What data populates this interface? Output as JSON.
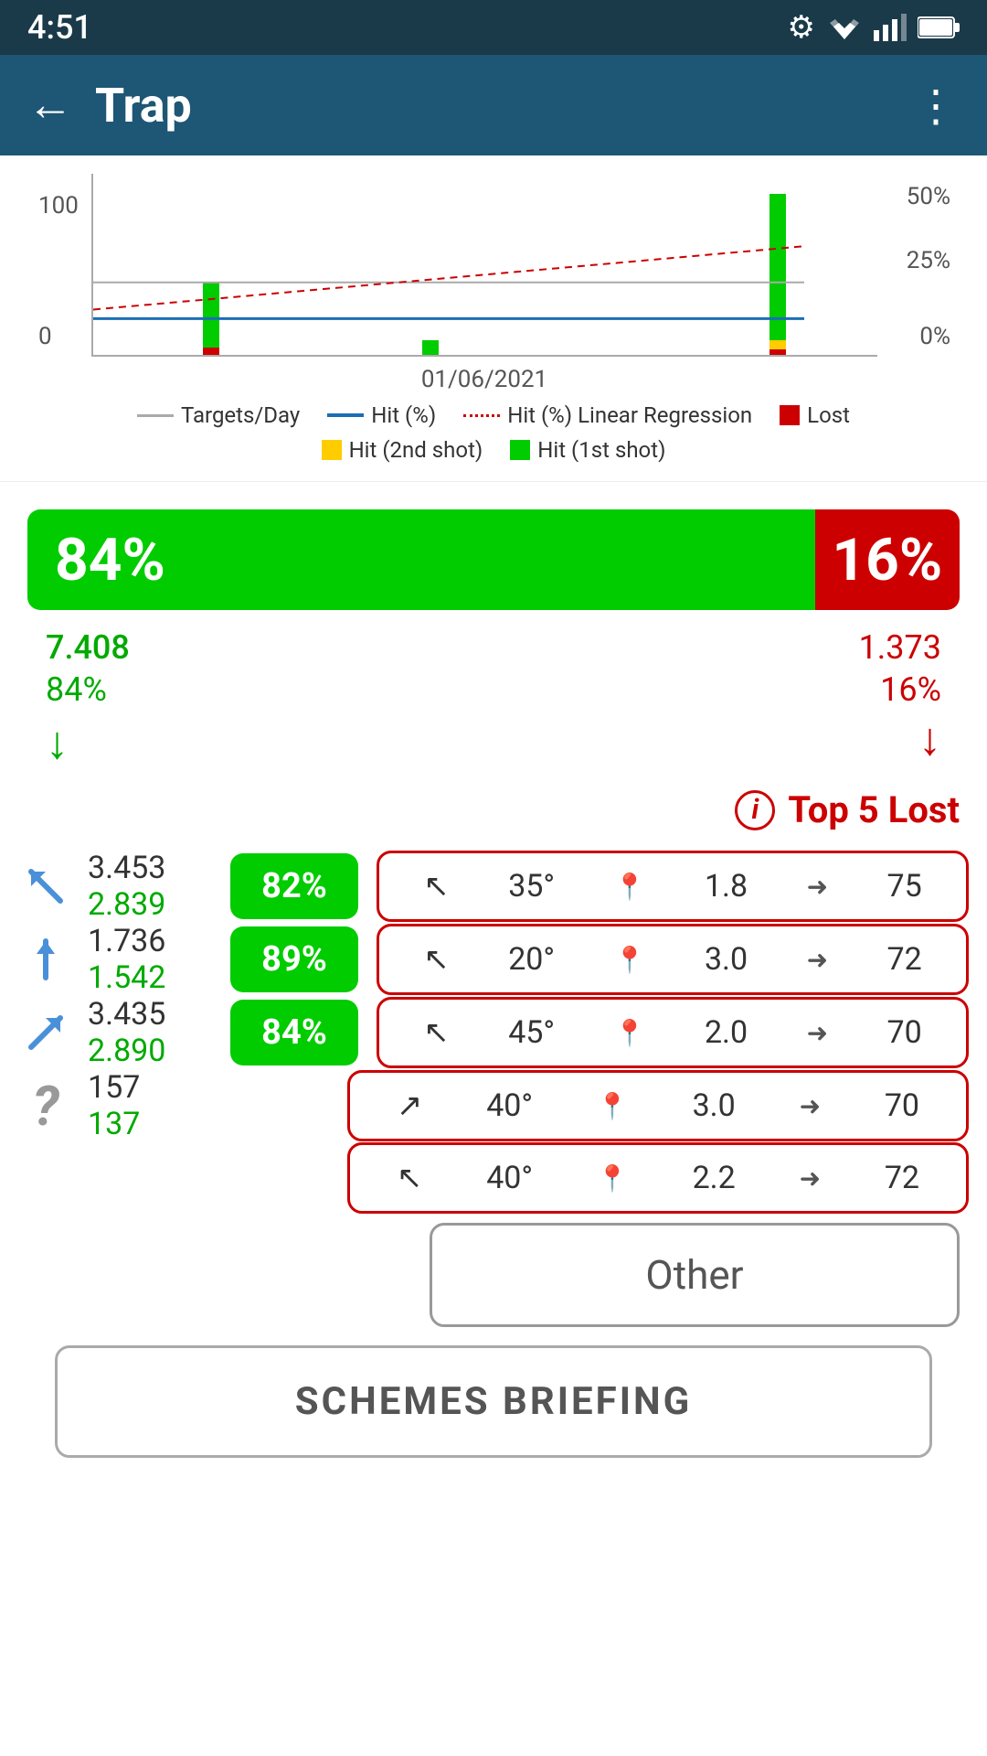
{
  "statusBar": {
    "time": "4:51",
    "gearIcon": "⚙"
  },
  "topBar": {
    "title": "Trap",
    "backIcon": "←",
    "menuIcon": "⋮"
  },
  "chart": {
    "yLabels": [
      "100",
      "0"
    ],
    "yRightLabels": [
      "50%",
      "25%",
      "0%"
    ],
    "dateLabel": "01/06/2021",
    "legend": [
      {
        "type": "line",
        "color": "gray",
        "label": "Targets/Day"
      },
      {
        "type": "line",
        "color": "blue",
        "label": "Hit (%)"
      },
      {
        "type": "dotted",
        "color": "red",
        "label": "Hit (%) Linear Regression"
      },
      {
        "type": "rect",
        "color": "red",
        "label": "Lost"
      },
      {
        "type": "rect",
        "color": "yellow",
        "label": "Hit (2nd shot)"
      },
      {
        "type": "rect",
        "color": "green",
        "label": "Hit (1st shot)"
      }
    ]
  },
  "hitBar": {
    "greenPct": "84%",
    "redPct": "16%"
  },
  "statsLeft": {
    "number": "7.408",
    "percent": "84%",
    "arrow": "↓"
  },
  "statsRight": {
    "number": "1.373",
    "percent": "16%",
    "arrow": "↓"
  },
  "top5Lost": {
    "label": "Top 5 Lost"
  },
  "rows": [
    {
      "directionType": "up-left",
      "total": "3.453",
      "hit": "2.839",
      "pct": "82%",
      "lostAngle": "35°",
      "lostHeight": "1.8",
      "lostDist": "75"
    },
    {
      "directionType": "up",
      "total": "1.736",
      "hit": "1.542",
      "pct": "89%",
      "lostAngle": "20°",
      "lostHeight": "3.0",
      "lostDist": "72"
    },
    {
      "directionType": "up-right",
      "total": "3.435",
      "hit": "2.890",
      "pct": "84%",
      "lostAngle": "45°",
      "lostHeight": "2.0",
      "lostDist": "70"
    },
    {
      "directionType": "unknown",
      "total": "157",
      "hit": "137",
      "pct": null,
      "lostAngle": "40°",
      "lostHeight": "3.0",
      "lostDist": "70",
      "arrowType": "up-right"
    }
  ],
  "extraLostBox": {
    "angle": "40°",
    "height": "2.2",
    "dist": "72",
    "arrowType": "up-left"
  },
  "otherButton": "Other",
  "schemesBriefingButton": "SCHEMES BRIEFING"
}
